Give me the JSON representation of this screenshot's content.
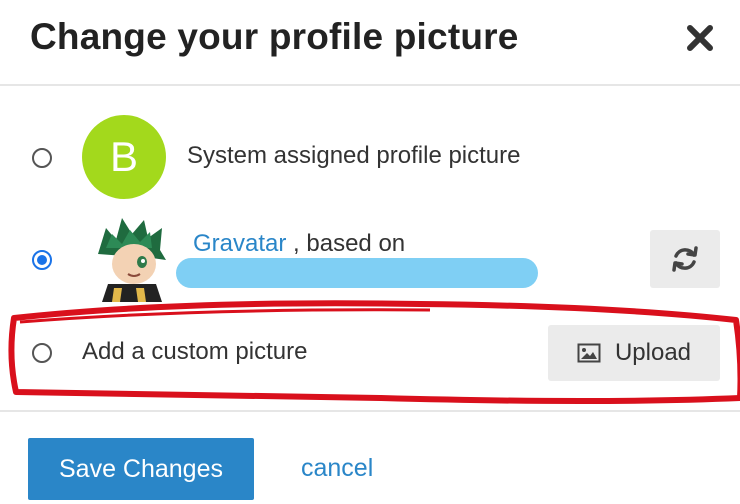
{
  "dialog": {
    "title": "Change your profile picture",
    "close_icon": "close-icon"
  },
  "options": {
    "system": {
      "avatar_letter": "B",
      "label": "System assigned profile picture",
      "selected": false
    },
    "gravatar": {
      "link_text": "Gravatar",
      "based_on_text": " , based on",
      "selected": true,
      "refresh_icon": "refresh-icon"
    },
    "custom": {
      "label": "Add a custom picture",
      "selected": false,
      "upload_label": "Upload",
      "upload_icon": "image-icon"
    }
  },
  "footer": {
    "save_label": "Save Changes",
    "cancel_label": "cancel"
  },
  "colors": {
    "accent": "#2a86c8",
    "avatar_bg": "#a3d91c",
    "annotation_red": "#d9101c",
    "redaction_blue": "#7fcff4"
  }
}
